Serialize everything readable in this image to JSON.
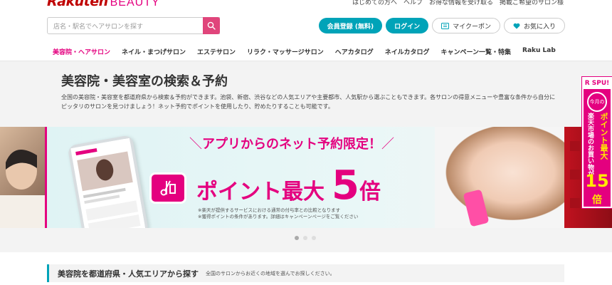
{
  "header": {
    "logo_main": "Rakuten",
    "logo_sub": "BEAUTY",
    "top_links": [
      "はじめての方へ",
      "ヘルプ",
      "お得な情報を受け取る",
      "掲載ご希望のサロン様"
    ]
  },
  "search": {
    "placeholder": "店名・駅名でヘアサロンを探す"
  },
  "actions": {
    "register": "会員登録 (無料)",
    "login": "ログイン",
    "coupon": "マイクーポン",
    "favorites": "お気に入り"
  },
  "nav": {
    "items": [
      {
        "label": "美容院・ヘアサロン",
        "active": true
      },
      {
        "label": "ネイル・まつげサロン",
        "active": false
      },
      {
        "label": "エステサロン",
        "active": false
      },
      {
        "label": "リラク・マッサージサロン",
        "active": false
      },
      {
        "label": "ヘアカタログ",
        "active": false
      },
      {
        "label": "ネイルカタログ",
        "active": false
      },
      {
        "label": "キャンペーン一覧・特集",
        "active": false
      },
      {
        "label": "Raku Lab",
        "active": false
      }
    ]
  },
  "main": {
    "title": "美容院・美容室の検索＆予約",
    "description": "全国の美容院・美容室を都道府県から検索＆予約ができます。池袋、新宿、渋谷などの人気エリアや主要都市、人気駅から選ぶこともできます。各サロンの得意メニューや豊富な条件から自分にピッタリのサロンを見つけましょう！ネット予約でポイントを使用したり、貯めたりすることも可能です。"
  },
  "banner": {
    "headline": "アプリからのネット予約限定！",
    "point_text": "ポイント最大",
    "multiplier": "5",
    "multiplier_unit": "倍",
    "note_line1": "※楽天が提供するサービスにおける通常の付与率との比較となります",
    "note_line2": "※獲得ポイントの条件があります。詳細はキャンペーンページをご覧ください",
    "active_slide": 0,
    "slide_count": 3
  },
  "side_ad": {
    "top": "R SPU!",
    "circle": "今月の",
    "vertical_white": "楽天市場のお買い物が",
    "vertical_yellow": "ポイント最大",
    "big_number": "15",
    "unit": "倍"
  },
  "section": {
    "title": "美容院を都道府県・人気エリアから探す",
    "subtitle": "全国のサロンからお近くの地域を選んでお探しください。"
  },
  "colors": {
    "brand_pink": "#e4007f",
    "teal": "#00a3b8",
    "rakuten_red": "#bf0000"
  }
}
